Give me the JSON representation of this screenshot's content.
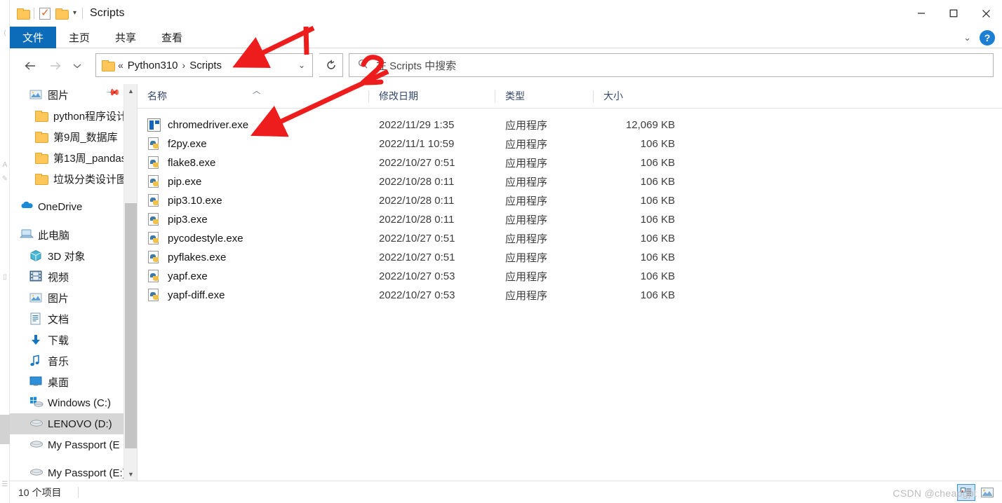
{
  "window": {
    "title": "Scripts",
    "quick_access": {
      "folder_icon": "folder-icon",
      "properties_icon": "properties-checkbox-icon",
      "new_folder_icon": "folder-icon",
      "dropdown_icon": "chevron-down-icon"
    },
    "controls": {
      "minimize": "minimize-icon",
      "maximize": "maximize-icon",
      "close": "close-icon"
    }
  },
  "ribbon": {
    "tabs": [
      {
        "label": "文件",
        "active": true
      },
      {
        "label": "主页",
        "active": false
      },
      {
        "label": "共享",
        "active": false
      },
      {
        "label": "查看",
        "active": false
      }
    ],
    "collapse_icon": "chevron-down-icon",
    "help_label": "?"
  },
  "navbar": {
    "back_icon": "arrow-left-icon",
    "forward_icon": "arrow-right-icon",
    "recent_icon": "chevron-down-icon",
    "up_icon": "arrow-up-icon",
    "address": {
      "folder_icon": "folder-icon",
      "overflow": "«",
      "crumbs": [
        "Python310",
        "Scripts"
      ],
      "separator": "›",
      "dropdown_icon": "chevron-down-icon"
    },
    "refresh_icon": "refresh-icon",
    "search": {
      "icon": "search-icon",
      "placeholder": "在 Scripts 中搜索",
      "value": ""
    }
  },
  "sidebar": {
    "items": [
      {
        "label": "图片",
        "icon": "pictures-icon",
        "level": 1,
        "pinned": true,
        "selected": false
      },
      {
        "label": "python程序设计",
        "icon": "folder-icon",
        "level": 2,
        "selected": false
      },
      {
        "label": "第9周_数据库",
        "icon": "folder-icon",
        "level": 2,
        "selected": false
      },
      {
        "label": "第13周_pandas",
        "icon": "folder-icon",
        "level": 2,
        "selected": false
      },
      {
        "label": "垃圾分类设计图",
        "icon": "folder-icon",
        "level": 2,
        "selected": false
      },
      {
        "label": "OneDrive",
        "icon": "onedrive-icon",
        "level": 0,
        "selected": false,
        "gap_before": true
      },
      {
        "label": "此电脑",
        "icon": "this-pc-icon",
        "level": 0,
        "selected": false,
        "gap_before": true
      },
      {
        "label": "3D 对象",
        "icon": "3d-objects-icon",
        "level": 1,
        "selected": false
      },
      {
        "label": "视频",
        "icon": "videos-icon",
        "level": 1,
        "selected": false
      },
      {
        "label": "图片",
        "icon": "pictures-icon",
        "level": 1,
        "selected": false
      },
      {
        "label": "文档",
        "icon": "documents-icon",
        "level": 1,
        "selected": false
      },
      {
        "label": "下载",
        "icon": "downloads-icon",
        "level": 1,
        "selected": false
      },
      {
        "label": "音乐",
        "icon": "music-icon",
        "level": 1,
        "selected": false
      },
      {
        "label": "桌面",
        "icon": "desktop-icon",
        "level": 1,
        "selected": false
      },
      {
        "label": "Windows (C:)",
        "icon": "windows-drive-icon",
        "level": 1,
        "selected": false
      },
      {
        "label": "LENOVO (D:)",
        "icon": "drive-icon",
        "level": 1,
        "selected": true
      },
      {
        "label": "My Passport (E",
        "icon": "drive-icon",
        "level": 1,
        "selected": false
      },
      {
        "label": "My Passport (E:)",
        "icon": "drive-icon",
        "level": 1,
        "selected": false,
        "gap_before": true
      }
    ],
    "scroll_up_icon": "chevron-up-icon",
    "scroll_down_icon": "chevron-down-icon"
  },
  "filelist": {
    "columns": [
      {
        "label": "名称",
        "sorted": "asc",
        "sort_icon": "caret-up-icon"
      },
      {
        "label": "修改日期"
      },
      {
        "label": "类型"
      },
      {
        "label": "大小"
      }
    ],
    "rows": [
      {
        "name": "chromedriver.exe",
        "icon": "exe-icon",
        "date": "2022/11/29 1:35",
        "type": "应用程序",
        "size": "12,069 KB"
      },
      {
        "name": "f2py.exe",
        "icon": "python-exe-icon",
        "date": "2022/11/1 10:59",
        "type": "应用程序",
        "size": "106 KB"
      },
      {
        "name": "flake8.exe",
        "icon": "python-exe-icon",
        "date": "2022/10/27 0:51",
        "type": "应用程序",
        "size": "106 KB"
      },
      {
        "name": "pip.exe",
        "icon": "python-exe-icon",
        "date": "2022/10/28 0:11",
        "type": "应用程序",
        "size": "106 KB"
      },
      {
        "name": "pip3.10.exe",
        "icon": "python-exe-icon",
        "date": "2022/10/28 0:11",
        "type": "应用程序",
        "size": "106 KB"
      },
      {
        "name": "pip3.exe",
        "icon": "python-exe-icon",
        "date": "2022/10/28 0:11",
        "type": "应用程序",
        "size": "106 KB"
      },
      {
        "name": "pycodestyle.exe",
        "icon": "python-exe-icon",
        "date": "2022/10/27 0:51",
        "type": "应用程序",
        "size": "106 KB"
      },
      {
        "name": "pyflakes.exe",
        "icon": "python-exe-icon",
        "date": "2022/10/27 0:51",
        "type": "应用程序",
        "size": "106 KB"
      },
      {
        "name": "yapf.exe",
        "icon": "python-exe-icon",
        "date": "2022/10/27 0:53",
        "type": "应用程序",
        "size": "106 KB"
      },
      {
        "name": "yapf-diff.exe",
        "icon": "python-exe-icon",
        "date": "2022/10/27 0:53",
        "type": "应用程序",
        "size": "106 KB"
      }
    ]
  },
  "statusbar": {
    "item_count": "10 个项目",
    "view_details_icon": "details-view-icon",
    "view_tiles_icon": "large-icons-view-icon"
  },
  "watermark": {
    "text": "CSDN @cheapgpt"
  },
  "annotations": [
    {
      "label": "1",
      "target": "address-bar-path"
    },
    {
      "label": "2",
      "target": "chromedriver-exe-row"
    }
  ],
  "colors": {
    "accent": "#0d6cb9",
    "selection": "#d6d6d6",
    "annotation_red": "#ee1d1d",
    "header_text": "#34486a"
  }
}
